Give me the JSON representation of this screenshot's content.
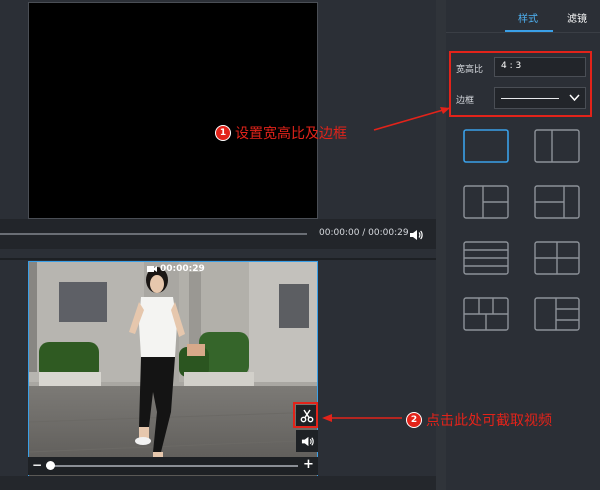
{
  "preview": {
    "time_display": "00:00:00 / 00:00:29"
  },
  "clip": {
    "duration": "00:00:29"
  },
  "panel": {
    "tabs": [
      {
        "label": "样式",
        "active": true
      },
      {
        "label": "滤镜",
        "active": false
      }
    ],
    "aspect_ratio_label": "宽高比",
    "aspect_ratio_value": "4 : 3",
    "border_label": "边框",
    "layout_options": [
      "single",
      "two-columns",
      "big-plus-two-right",
      "two-plus-one",
      "four-rows",
      "grid-four",
      "three-plus-two",
      "side-three"
    ]
  },
  "annotations": [
    {
      "badge": "1",
      "text": "设置宽高比及边框"
    },
    {
      "badge": "2",
      "text": "点击此处可截取视频"
    }
  ],
  "colors": {
    "accent": "#3aa0e8",
    "annotation_red": "#e2231a",
    "background": "#2b2f36"
  },
  "icons": [
    "volume-icon",
    "camera-icon",
    "scissors-icon",
    "chevron-down-icon"
  ]
}
